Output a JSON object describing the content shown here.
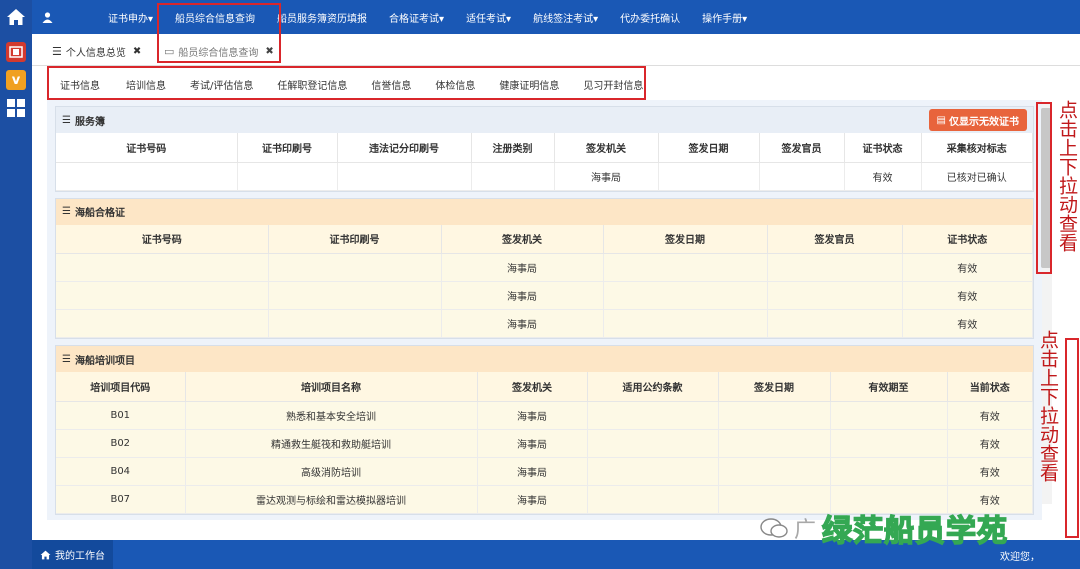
{
  "nav": {
    "menus": [
      "证书申办▾",
      "船员综合信息查询",
      "船员服务簿资历填报",
      "合格证考试▾",
      "适任考试▾",
      "航线签注考试▾",
      "代办委托确认",
      "操作手册▾"
    ]
  },
  "page_tabs": [
    {
      "label": "个人信息总览"
    },
    {
      "label": "船员综合信息查询"
    }
  ],
  "sub_tabs": [
    "证书信息",
    "培训信息",
    "考试/评估信息",
    "任解职登记信息",
    "信誉信息",
    "体检信息",
    "健康证明信息",
    "见习开封信息"
  ],
  "service_book": {
    "title": "服务簿",
    "only_invalid_label": "仅显示无效证书",
    "headers": [
      "证书号码",
      "证书印刷号",
      "违法记分印刷号",
      "注册类别",
      "签发机关",
      "签发日期",
      "签发官员",
      "证书状态",
      "采集核对标志"
    ],
    "rows": [
      [
        "",
        "",
        "",
        "",
        "海事局",
        "",
        "",
        "有效",
        "已核对已确认"
      ]
    ]
  },
  "ship_cert": {
    "title": "海船合格证",
    "headers": [
      "证书号码",
      "证书印刷号",
      "签发机关",
      "签发日期",
      "签发官员",
      "证书状态"
    ],
    "rows": [
      [
        "",
        "",
        "海事局",
        "",
        "",
        "有效"
      ],
      [
        "",
        "",
        "海事局",
        "",
        "",
        "有效"
      ],
      [
        "",
        "",
        "海事局",
        "",
        "",
        "有效"
      ]
    ]
  },
  "training": {
    "title": "海船培训项目",
    "headers": [
      "培训项目代码",
      "培训项目名称",
      "签发机关",
      "适用公约条款",
      "签发日期",
      "有效期至",
      "当前状态"
    ],
    "rows": [
      [
        "B01",
        "熟悉和基本安全培训",
        "海事局",
        "",
        "",
        "",
        "有效"
      ],
      [
        "B02",
        "精通救生艇筏和救助艇培训",
        "海事局",
        "",
        "",
        "",
        "有效"
      ],
      [
        "B04",
        "高级消防培训",
        "海事局",
        "",
        "",
        "",
        "有效"
      ],
      [
        "B07",
        "雷达观测与标绘和雷达模拟器培训",
        "海事局",
        "",
        "",
        "",
        "有效"
      ]
    ]
  },
  "annotations": {
    "scroll_hint_1": "点击上下拉动查看",
    "scroll_hint_2": "点击上下拉动查看"
  },
  "footer": {
    "workbench": "我的工作台",
    "welcome": "欢迎您，"
  },
  "watermark": {
    "left": "广",
    "main": "绿茫船员学苑"
  },
  "colors": {
    "nav_blue": "#1a58b5",
    "sidebar_blue": "#1c4fa3",
    "highlight_red": "#d9262b",
    "button_orange": "#e8643c",
    "gold_section": "#fde6c6"
  }
}
